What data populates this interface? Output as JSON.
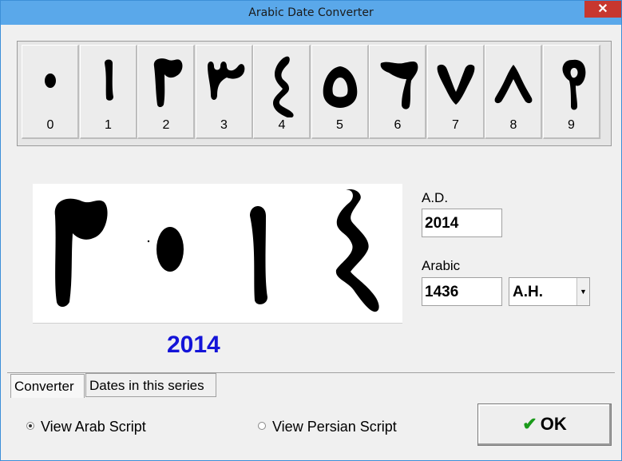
{
  "window": {
    "title": "Arabic Date Converter",
    "close_glyph": "✕"
  },
  "digits": [
    {
      "label": "0",
      "glyph": "٠"
    },
    {
      "label": "1",
      "glyph": "١"
    },
    {
      "label": "2",
      "glyph": "٢"
    },
    {
      "label": "3",
      "glyph": "٣"
    },
    {
      "label": "4",
      "glyph": "٤"
    },
    {
      "label": "5",
      "glyph": "٥"
    },
    {
      "label": "6",
      "glyph": "٦"
    },
    {
      "label": "7",
      "glyph": "٧"
    },
    {
      "label": "8",
      "glyph": "٨"
    },
    {
      "label": "9",
      "glyph": "٩"
    }
  ],
  "display": {
    "arabic_glyphs": "٢٠١٤",
    "year_text": "2014",
    "year_color": "#1414d8"
  },
  "ad": {
    "label": "A.D.",
    "value": "2014"
  },
  "arabic": {
    "label": "Arabic",
    "value": "1436",
    "era_selected": "A.H."
  },
  "tabs": [
    {
      "label": "Converter",
      "active": true
    },
    {
      "label": "Dates in this series",
      "active": false
    }
  ],
  "options": {
    "arab_script": "View Arab Script",
    "persian_script": "View Persian Script",
    "selected": "arab"
  },
  "ok_button": {
    "label": "OK",
    "icon": "check-icon"
  }
}
